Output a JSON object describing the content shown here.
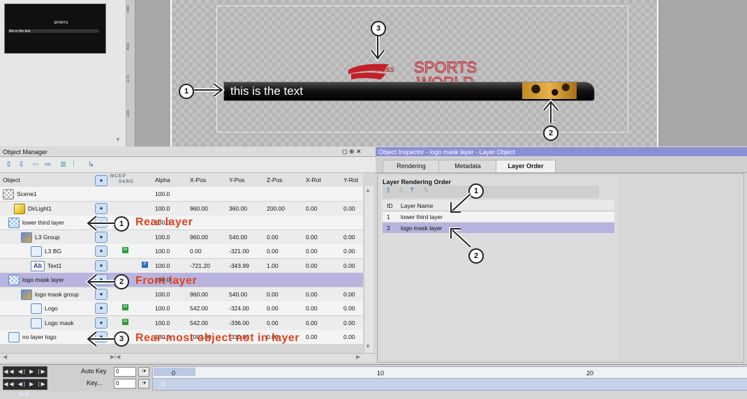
{
  "preview": {
    "thumb_text": "this is the text",
    "thumb_logo": "SPORTS",
    "ruler_labels": [
      "540",
      "403",
      "270",
      "135"
    ],
    "bar_text": "this is the text",
    "logo_brand": "ROSS",
    "logo_sports": "SPORTS",
    "logo_world": "WORLD"
  },
  "object_manager": {
    "title": "Object Manager",
    "header_icons": "◻ ⊕ ✕",
    "toolbar_icons": [
      "⇧",
      "⇩",
      "⇦",
      "⇨",
      "≣",
      "⁞",
      "↳"
    ],
    "columns": {
      "object": "Object",
      "vis": "👁",
      "flags_top": "MCEP",
      "flags_bottom": "SKBD",
      "alpha": "Alpha",
      "xpos": "X-Pos",
      "ypos": "Y-Pos",
      "zpos": "Z-Pos",
      "xrot": "X-Rot",
      "yrot": "Y-Rot"
    },
    "rows": [
      {
        "name": "Scene1",
        "alpha": "100.0",
        "x": "",
        "y": "",
        "z": "",
        "xrot": "",
        "yrot": ""
      },
      {
        "name": "DirLight1",
        "alpha": "100.0",
        "x": "960.00",
        "y": "360.00",
        "z": "200.00",
        "xrot": "0.00",
        "yrot": "0.00"
      },
      {
        "name": "lower third layer",
        "alpha": "100.0",
        "x": "",
        "y": "",
        "z": "",
        "xrot": "",
        "yrot": ""
      },
      {
        "name": "L3 Group",
        "alpha": "100.0",
        "x": "960.00",
        "y": "540.00",
        "z": "0.00",
        "xrot": "0.00",
        "yrot": "0.00"
      },
      {
        "name": "L3 BG",
        "alpha": "100.0",
        "x": "0.00",
        "y": "-321.00",
        "z": "0.00",
        "xrot": "0.00",
        "yrot": "0.00",
        "flag": "M"
      },
      {
        "name": "Text1",
        "alpha": "100.0",
        "x": "-721.20",
        "y": "-343.99",
        "z": "1.00",
        "xrot": "0.00",
        "yrot": "0.00",
        "flag": "P"
      },
      {
        "name": "logo mask layer",
        "alpha": "100.0",
        "x": "",
        "y": "",
        "z": "",
        "xrot": "",
        "yrot": ""
      },
      {
        "name": "logo mask group",
        "alpha": "100.0",
        "x": "960.00",
        "y": "540.00",
        "z": "0.00",
        "xrot": "0.00",
        "yrot": "0.00"
      },
      {
        "name": "Logo",
        "alpha": "100.0",
        "x": "542.00",
        "y": "-324.00",
        "z": "0.00",
        "xrot": "0.00",
        "yrot": "0.00",
        "flag": "M"
      },
      {
        "name": "Logo mask",
        "alpha": "100.0",
        "x": "542.00",
        "y": "-336.00",
        "z": "0.00",
        "xrot": "0.00",
        "yrot": "0.00",
        "flag": "M"
      },
      {
        "name": "no layer logo",
        "alpha": "100.0",
        "x": "1002.00",
        "y": "-330.00",
        "z": "0.00",
        "xrot": "0.00",
        "yrot": "0.00"
      }
    ]
  },
  "inspector": {
    "title": "Object Inspector - logo mask layer - Layer Object",
    "tabs": [
      "Rendering",
      "Metadata",
      "Layer Order"
    ],
    "panel_title": "Layer Rendering Order",
    "table_headers": {
      "id": "ID",
      "name": "Layer Name"
    },
    "layers": [
      {
        "id": "1",
        "name": "lower third layer"
      },
      {
        "id": "2",
        "name": "logo mask layer"
      }
    ]
  },
  "timeline": {
    "transport": "◀◀ ◀| ▶ |▶ ▶▶",
    "auto_key_label": "Auto Key",
    "auto_key_value": "0",
    "key_label": "Key...",
    "key_value": "0",
    "track_value_1": "0",
    "track_value_2": "0",
    "ticks": [
      "10",
      "20"
    ]
  },
  "callouts": {
    "badges": [
      "1",
      "2",
      "3",
      "1",
      "2",
      "1",
      "2",
      "3"
    ],
    "rear_layer": "Rear layer",
    "front_layer": "Front layer",
    "rear_most": "Rear-most object not in layer"
  },
  "colors": {
    "callout_red": "#e2431e",
    "selected_row": "#b8b4df",
    "inspector_header": "#8a8fd6"
  }
}
